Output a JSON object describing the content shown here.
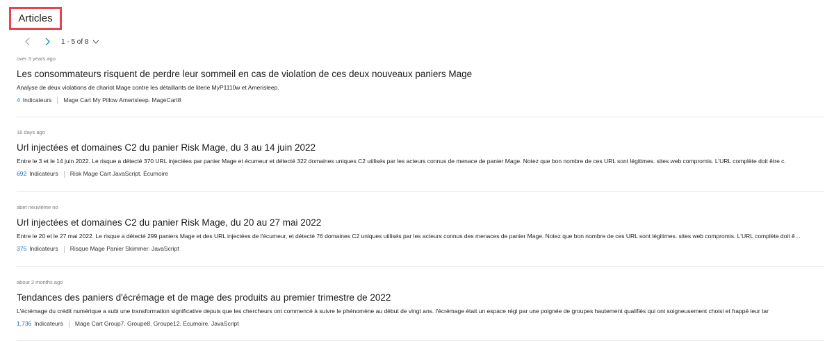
{
  "section_title": "Articles",
  "pager": {
    "range": "1 - 5 of 8",
    "prev_icon": "chevron-left-icon",
    "next_icon": "chevron-right-icon",
    "dropdown_icon": "chevron-down-icon"
  },
  "articles": [
    {
      "ago": "over 3 years ago",
      "headline": "Les consommateurs risquent de perdre leur sommeil en cas de violation de ces deux nouveaux paniers Mage",
      "description": "Analyse de deux violations de chariot Mage contre les détaillants de literie MyP1110w et Amerisleep.",
      "indicator_count": "4",
      "indicator_label": "Indicateurs",
      "tags": "Mage Cart My Pillow Amerisleep. MageCart8"
    },
    {
      "ago": "16 days ago",
      "headline": "Url injectées et domaines C2 du panier Risk Mage, du 3 au 14 juin 2022",
      "description": "Entre le 3 et le 14 juin 2022. Le risque a détecté 370 URL injectées par panier Mage et écumeur et détecté 322 domaines uniques C2 utilisés par les acteurs connus de menace de panier Mage. Notez que bon nombre de ces URL sont légitimes. sites web compromis. L'URL complète doit être c.",
      "indicator_count": "692",
      "indicator_label": "Indicateurs",
      "tags": "Risk Mage Cart JavaScript. Écumoire"
    },
    {
      "ago": "abet neuvième no",
      "headline": "Url injectées et domaines C2 du panier Risk Mage, du 20 au 27 mai 2022",
      "description": "Entre le 20 et le 27 mai 2022. Le risque a détecté 299 paniers Mage et des URL injectées de l'écumeur, et détecté 76 domaines C2 uniques utilisés par les acteurs connus des menaces de panier Mage. Notez que bon nombre de ces URL sont légitimes. sites web compromis. L'URL complète doit être c..",
      "indicator_count": "375",
      "indicator_label": "Indicateurs",
      "tags": "Risque Mage Panier Skimmer. JavaScript"
    },
    {
      "ago": "about 2 months ago",
      "headline": "Tendances des paniers d'écrémage et de mage des produits au premier trimestre de 2022",
      "description": "L'écrémage du crédit numérique a subi une transformation significative depuis que les chercheurs ont commencé à suivre le phénomène au début de vingt ans. l'écrémage était un espace régi par une poignée de groupes hautement qualifiés qui ont soigneusement choisi et frappé leur tar",
      "indicator_count": "1,736",
      "indicator_label": "Indicateurs",
      "tags": "Mage Cart Group7. Groupe8. Groupe12. Écumoire. JavaScript"
    }
  ]
}
